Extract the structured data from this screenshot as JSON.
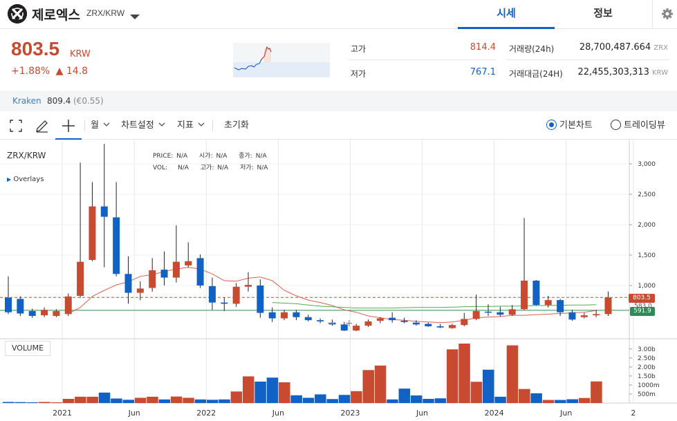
{
  "header": {
    "coin_name": "제로엑스",
    "pair": "ZRX/KRW",
    "tabs": [
      {
        "label": "시세"
      },
      {
        "label": "정보"
      }
    ]
  },
  "price": {
    "current": "803.5",
    "unit": "KRW",
    "change_pct": "+1.88%",
    "change_abs": "▲ 14.8",
    "high_label": "고가",
    "high": "814.4",
    "low_label": "저가",
    "low": "767.1",
    "volume_label": "거래량(24h)",
    "volume": "28,700,487.664",
    "volume_unit": "ZRX",
    "amount_label": "거래대금(24H)",
    "amount": "22,455,303,313",
    "amount_unit": "KRW"
  },
  "exchange": {
    "name": "Kraken",
    "price": "809.4",
    "eur": "(€0.55)"
  },
  "toolbar": {
    "period": "월",
    "chart_settings": "차트설정",
    "indicators": "지표",
    "reset": "초기화",
    "basic_chart": "기본차트",
    "tradingview": "트레이딩뷰"
  },
  "chart_info": {
    "symbol": "ZRX/KRW",
    "overlays": "Overlays",
    "price_label": "PRICE:",
    "price_val": "N/A",
    "open_label": "시가:",
    "open_val": "N/A",
    "close_label": "종가:",
    "close_val": "N/A",
    "vol_label": "VOL:",
    "vol_val": "N/A",
    "high_label": "고가:",
    "high_val": "N/A",
    "low_label": "저가:",
    "low_val": "N/A",
    "volume_title": "VOLUME",
    "price_tag": "803.5",
    "ma_tag_1": "583.0",
    "ma_tag_2": "591.9"
  },
  "colors": {
    "up": "#c84a31",
    "down": "#1261c4",
    "ma_short": "#e05c4c",
    "ma_long": "#4cb04c",
    "ma_green": "#2e8b57"
  },
  "chart_data": {
    "type": "candlestick",
    "y_ticks": [
      "3,000",
      "2,500",
      "2,000",
      "1,500",
      "1,000"
    ],
    "y_tick_values": [
      3000,
      2500,
      2000,
      1500,
      1000
    ],
    "x_ticks": [
      "2021",
      "Jun",
      "2022",
      "Jun",
      "2023",
      "Jun",
      "2024",
      "Jun",
      "2"
    ],
    "volume_ticks": [
      "3.00b",
      "2.50b",
      "2.00b",
      "1.50b",
      "1000m",
      "500m"
    ],
    "volume_tick_values": [
      3000,
      2500,
      2000,
      1500,
      1000,
      500
    ],
    "candles": [
      {
        "o": 800,
        "c": 560,
        "h": 1150,
        "l": 530
      },
      {
        "o": 780,
        "c": 540,
        "h": 820,
        "l": 500
      },
      {
        "o": 580,
        "c": 500,
        "h": 620,
        "l": 470
      },
      {
        "o": 510,
        "c": 600,
        "h": 640,
        "l": 480
      },
      {
        "o": 500,
        "c": 580,
        "h": 610,
        "l": 480
      },
      {
        "o": 530,
        "c": 820,
        "h": 870,
        "l": 500
      },
      {
        "o": 830,
        "c": 1390,
        "h": 3020,
        "l": 800
      },
      {
        "o": 1420,
        "c": 2300,
        "h": 2700,
        "l": 1400
      },
      {
        "o": 2300,
        "c": 2130,
        "h": 3330,
        "l": 1300
      },
      {
        "o": 2120,
        "c": 1190,
        "h": 2700,
        "l": 1150
      },
      {
        "o": 1190,
        "c": 880,
        "h": 1480,
        "l": 700
      },
      {
        "o": 880,
        "c": 950,
        "h": 1070,
        "l": 760
      },
      {
        "o": 960,
        "c": 1250,
        "h": 1450,
        "l": 900
      },
      {
        "o": 1260,
        "c": 1130,
        "h": 1560,
        "l": 1000
      },
      {
        "o": 1130,
        "c": 1390,
        "h": 1990,
        "l": 1050
      },
      {
        "o": 1330,
        "c": 1400,
        "h": 1710,
        "l": 1300
      },
      {
        "o": 1450,
        "c": 1000,
        "h": 1510,
        "l": 960
      },
      {
        "o": 990,
        "c": 720,
        "h": 1130,
        "l": 600
      },
      {
        "o": 720,
        "c": 700,
        "h": 800,
        "l": 580
      },
      {
        "o": 700,
        "c": 980,
        "h": 1040,
        "l": 650
      },
      {
        "o": 980,
        "c": 1010,
        "h": 1220,
        "l": 900
      },
      {
        "o": 1000,
        "c": 550,
        "h": 1100,
        "l": 470
      },
      {
        "o": 560,
        "c": 460,
        "h": 640,
        "l": 400
      },
      {
        "o": 460,
        "c": 560,
        "h": 600,
        "l": 430
      },
      {
        "o": 560,
        "c": 480,
        "h": 600,
        "l": 430
      },
      {
        "o": 480,
        "c": 430,
        "h": 520,
        "l": 410
      },
      {
        "o": 430,
        "c": 410,
        "h": 460,
        "l": 380
      },
      {
        "o": 390,
        "c": 360,
        "h": 440,
        "l": 340
      },
      {
        "o": 360,
        "c": 260,
        "h": 400,
        "l": 250
      },
      {
        "o": 260,
        "c": 340,
        "h": 370,
        "l": 250
      },
      {
        "o": 340,
        "c": 410,
        "h": 440,
        "l": 320
      },
      {
        "o": 420,
        "c": 460,
        "h": 480,
        "l": 380
      },
      {
        "o": 470,
        "c": 430,
        "h": 560,
        "l": 390
      },
      {
        "o": 420,
        "c": 400,
        "h": 470,
        "l": 380
      },
      {
        "o": 390,
        "c": 360,
        "h": 430,
        "l": 340
      },
      {
        "o": 370,
        "c": 330,
        "h": 390,
        "l": 320
      },
      {
        "o": 330,
        "c": 310,
        "h": 370,
        "l": 300
      },
      {
        "o": 300,
        "c": 350,
        "h": 370,
        "l": 290
      },
      {
        "o": 350,
        "c": 450,
        "h": 550,
        "l": 330
      },
      {
        "o": 450,
        "c": 580,
        "h": 850,
        "l": 430
      },
      {
        "o": 570,
        "c": 560,
        "h": 690,
        "l": 500
      },
      {
        "o": 560,
        "c": 520,
        "h": 650,
        "l": 490
      },
      {
        "o": 520,
        "c": 610,
        "h": 680,
        "l": 500
      },
      {
        "o": 610,
        "c": 1080,
        "h": 2110,
        "l": 600
      },
      {
        "o": 1080,
        "c": 680,
        "h": 1090,
        "l": 670
      },
      {
        "o": 680,
        "c": 760,
        "h": 830,
        "l": 640
      },
      {
        "o": 760,
        "c": 560,
        "h": 780,
        "l": 500
      },
      {
        "o": 560,
        "c": 440,
        "h": 600,
        "l": 420
      },
      {
        "o": 480,
        "c": 510,
        "h": 550,
        "l": 460
      },
      {
        "o": 510,
        "c": 530,
        "h": 600,
        "l": 480
      },
      {
        "o": 530,
        "c": 803.5,
        "h": 900,
        "l": 500
      }
    ],
    "volumes": [
      60,
      50,
      40,
      60,
      40,
      230,
      350,
      350,
      580,
      250,
      180,
      290,
      350,
      200,
      360,
      290,
      200,
      180,
      200,
      640,
      1480,
      1190,
      1410,
      1150,
      430,
      290,
      480,
      220,
      450,
      660,
      1830,
      2080,
      200,
      800,
      420,
      230,
      260,
      2980,
      3300,
      1180,
      1850,
      350,
      3200,
      780,
      540,
      170,
      170,
      210,
      280,
      1200
    ],
    "ma_short": [
      null,
      null,
      null,
      null,
      null,
      540,
      640,
      820,
      920,
      1010,
      1060,
      1150,
      1180,
      1230,
      1270,
      1300,
      1270,
      1190,
      1080,
      1070,
      1120,
      1140,
      1080,
      920,
      830,
      760,
      720,
      670,
      600,
      560,
      500,
      470,
      440,
      430,
      410,
      400,
      390,
      400,
      430,
      470,
      480,
      490,
      510,
      510,
      520,
      530,
      540,
      550,
      560,
      590
    ],
    "ma_long": [
      null,
      null,
      null,
      null,
      null,
      null,
      null,
      null,
      null,
      null,
      null,
      null,
      null,
      null,
      null,
      null,
      null,
      null,
      null,
      null,
      null,
      null,
      720,
      710,
      700,
      680,
      660,
      650,
      640,
      630,
      630,
      630,
      630,
      635,
      640,
      640,
      640,
      645,
      650,
      655,
      655,
      660,
      660,
      665,
      670,
      670,
      675,
      680,
      680,
      685
    ],
    "hline_green": 591.9,
    "hline_dashed": 803.5,
    "y_range": [
      0,
      3300
    ],
    "volume_range": [
      0,
      3300
    ]
  }
}
